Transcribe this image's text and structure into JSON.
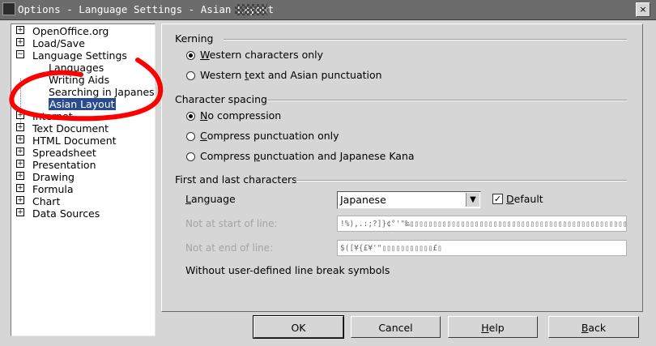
{
  "window": {
    "title": "Options - Language Settings - Asian Layout",
    "close_glyph": "×"
  },
  "tree": {
    "items": [
      {
        "label": "OpenOffice.org",
        "expander": "+"
      },
      {
        "label": "Load/Save",
        "expander": "+"
      },
      {
        "label": "Language Settings",
        "expander": "−"
      },
      {
        "label": "Languages"
      },
      {
        "label": "Writing Aids"
      },
      {
        "label": "Searching in Japanese"
      },
      {
        "label": "Asian Layout"
      },
      {
        "label": "Internet",
        "expander": "+"
      },
      {
        "label": "Text Document",
        "expander": "+"
      },
      {
        "label": "HTML Document",
        "expander": "+"
      },
      {
        "label": "Spreadsheet",
        "expander": "+"
      },
      {
        "label": "Presentation",
        "expander": "+"
      },
      {
        "label": "Drawing",
        "expander": "+"
      },
      {
        "label": "Formula",
        "expander": "+"
      },
      {
        "label": "Chart",
        "expander": "+"
      },
      {
        "label": "Data Sources",
        "expander": "+"
      }
    ]
  },
  "kerning": {
    "heading": "Kerning",
    "opt1_u": "W",
    "opt1_rest": "estern characters only",
    "opt2_a": "Western ",
    "opt2_u": "t",
    "opt2_b": "ext and Asian punctuation"
  },
  "spacing": {
    "heading": "Character spacing",
    "opt1_u": "N",
    "opt1_rest": "o compression",
    "opt2_u": "C",
    "opt2_rest": "ompress punctuation only",
    "opt3_a": "Compress ",
    "opt3_u": "p",
    "opt3_b": "unctuation and Japanese Kana"
  },
  "firstlast": {
    "heading": "First and last characters",
    "language_u": "L",
    "language_rest": "anguage",
    "language_value": "Japanese",
    "dropdown_glyph": "▼",
    "default_check": "✓",
    "default_u": "D",
    "default_rest": "efault",
    "not_start_label": "Not at start of line:",
    "not_start_value": "!%),.:;?]}¢°'\"‰▯▯▯▯▯▯▯▯▯▯▯▯▯▯▯▯▯▯▯▯▯▯▯▯▯▯▯▯▯▯▯▯▯▯▯▯▯▯▯▯▯▯▯▯▯▯▯▯▯▯▯▯▯▯▯▯▯▯▯▯▯▯▯▯▯▯▯▯",
    "not_end_label": "Not at end of line:",
    "not_end_value": "$([¥{£¥'\"▯▯▯▯▯▯▯▯▯▯▯£▯",
    "note": "Without user-defined line break symbols"
  },
  "buttons": {
    "ok": "OK",
    "cancel": "Cancel",
    "help_u": "H",
    "help_rest": "elp",
    "back_u": "B",
    "back_rest": "ack"
  },
  "colors": {
    "selection": "#2a4c8f",
    "annotation": "#ff0000"
  }
}
